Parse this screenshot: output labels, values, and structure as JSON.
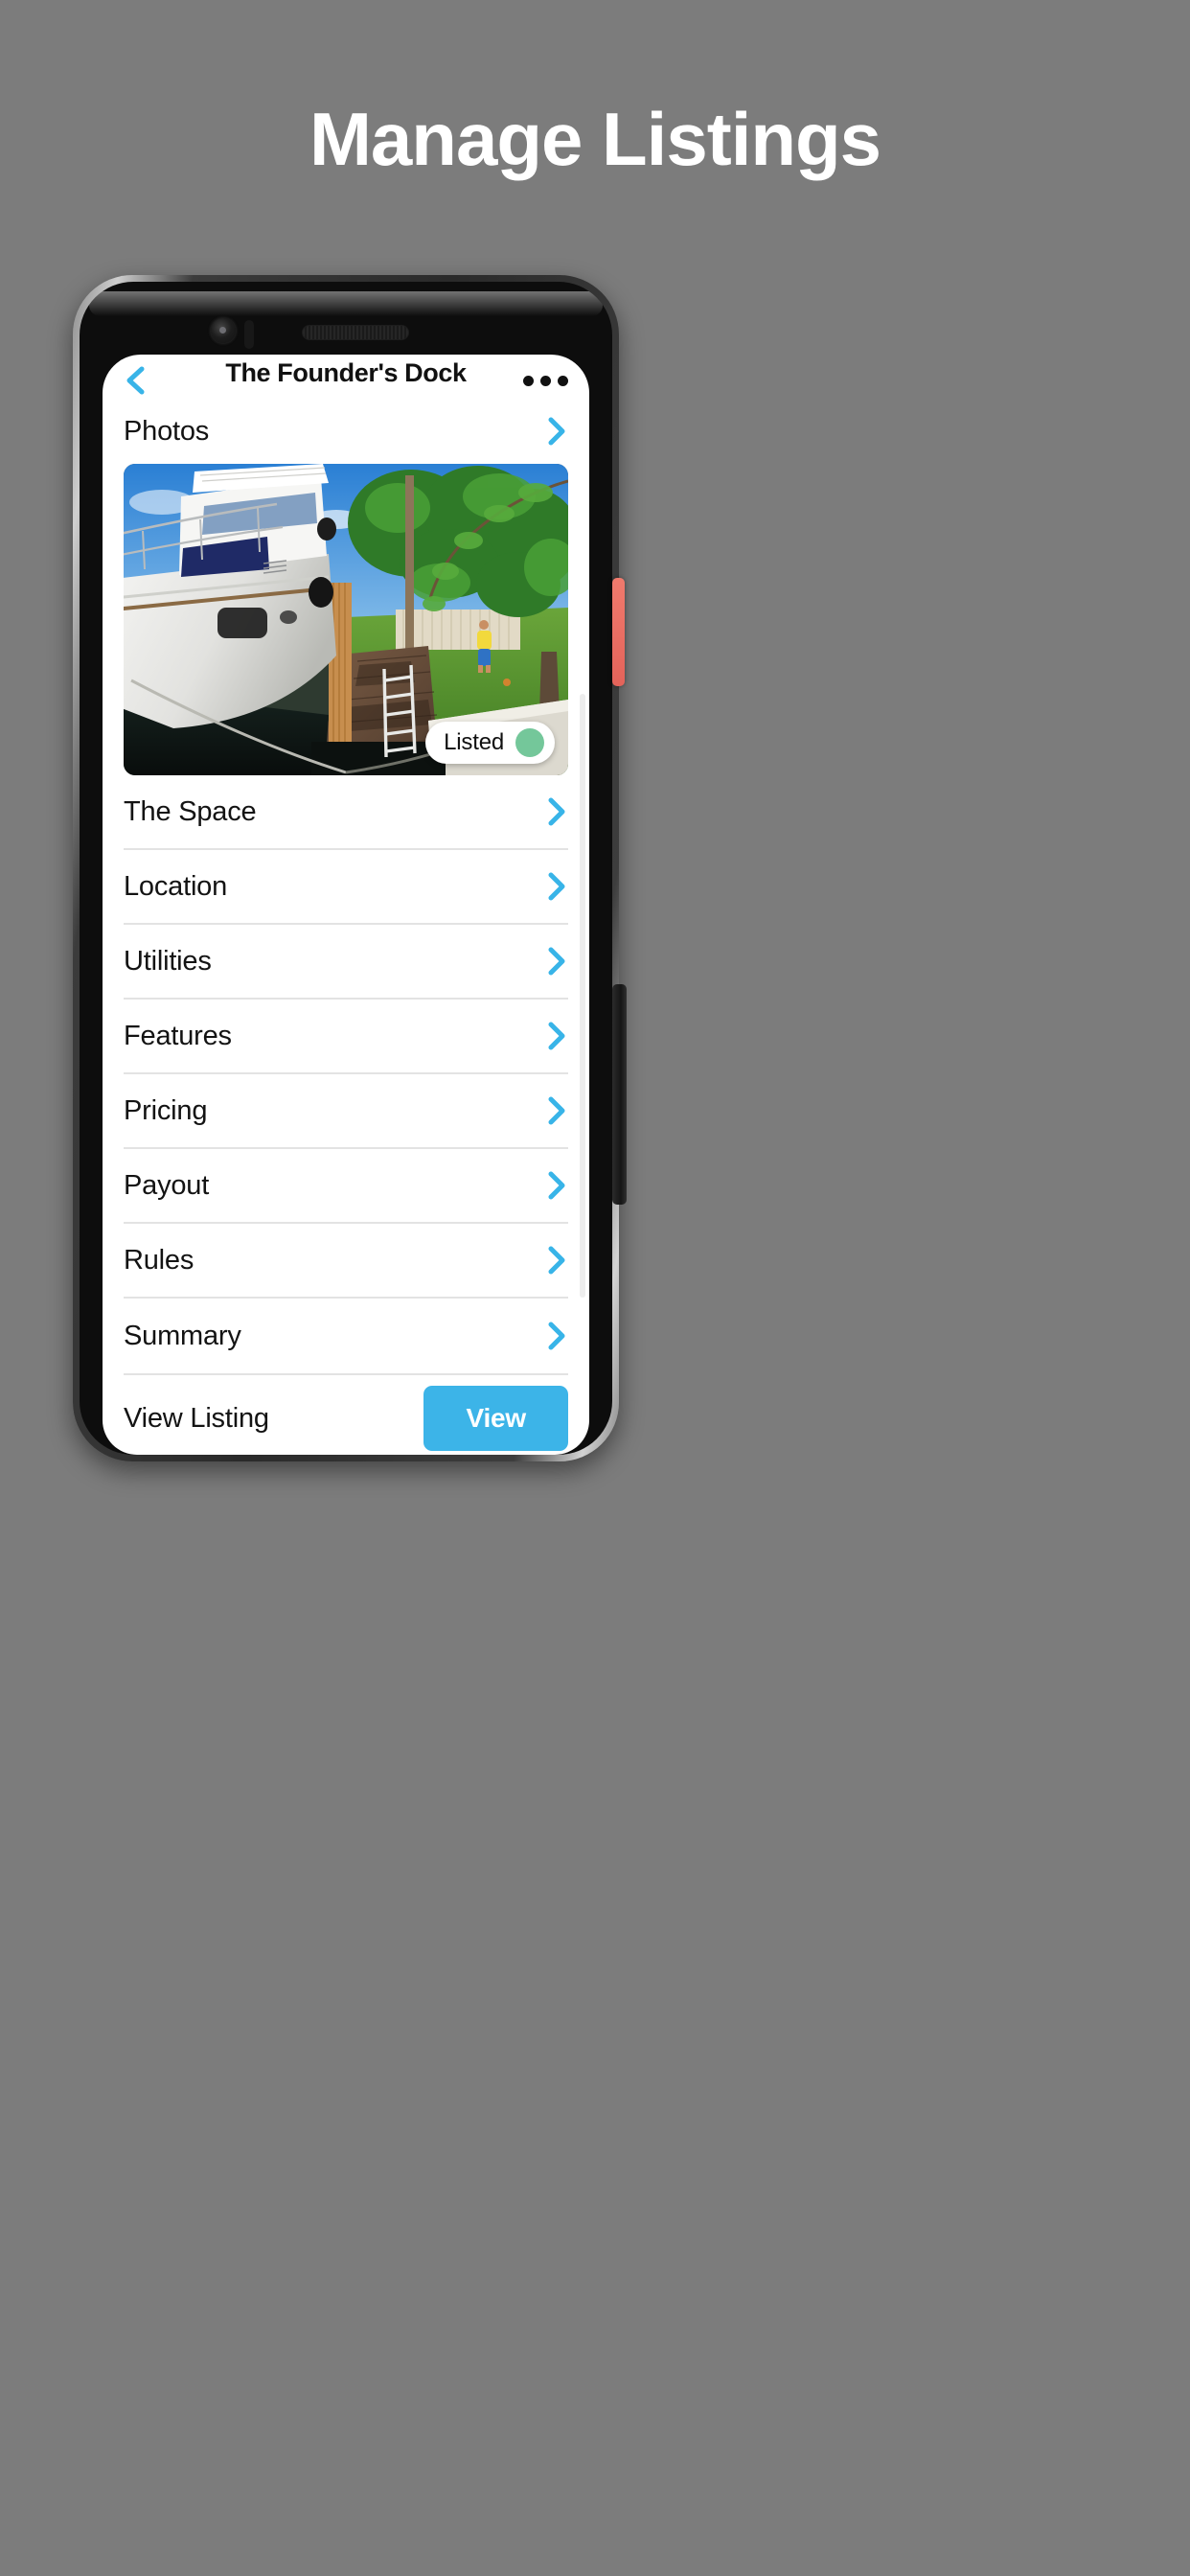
{
  "hero": {
    "title": "Manage Listings"
  },
  "colors": {
    "background": "#7c7c7c",
    "accent_blue": "#3cb4e8",
    "chevron_blue": "#38b4e8",
    "status_green": "#74c79a",
    "side_button_red": "#e4635a",
    "separator": "#e3e3e3",
    "text_primary": "#131313"
  },
  "device": {
    "camera_icon": "camera-lens-icon",
    "sensor_icon": "proximity-sensor-icon",
    "speaker_icon": "earpiece-speaker-icon",
    "side_button_accent": "side-accent-button",
    "side_button_power": "power-button"
  },
  "appbar": {
    "back_icon": "chevron-left-icon",
    "title": "The Founder's Dock",
    "more_icon": "more-horizontal-icon"
  },
  "photos_row": {
    "label": "Photos",
    "chevron_icon": "chevron-right-icon"
  },
  "photo": {
    "alt": "boat-docked-at-wooden-dock-photo",
    "badge": {
      "label": "Listed",
      "dot_icon": "status-dot-icon"
    }
  },
  "sections": [
    {
      "label": "The Space",
      "chevron_icon": "chevron-right-icon"
    },
    {
      "label": "Location",
      "chevron_icon": "chevron-right-icon"
    },
    {
      "label": "Utilities",
      "chevron_icon": "chevron-right-icon"
    },
    {
      "label": "Features",
      "chevron_icon": "chevron-right-icon"
    },
    {
      "label": "Pricing",
      "chevron_icon": "chevron-right-icon"
    },
    {
      "label": "Payout",
      "chevron_icon": "chevron-right-icon"
    },
    {
      "label": "Rules",
      "chevron_icon": "chevron-right-icon"
    },
    {
      "label": "Summary",
      "chevron_icon": "chevron-right-icon"
    }
  ],
  "footer": {
    "label": "View Listing",
    "button_label": "View"
  }
}
